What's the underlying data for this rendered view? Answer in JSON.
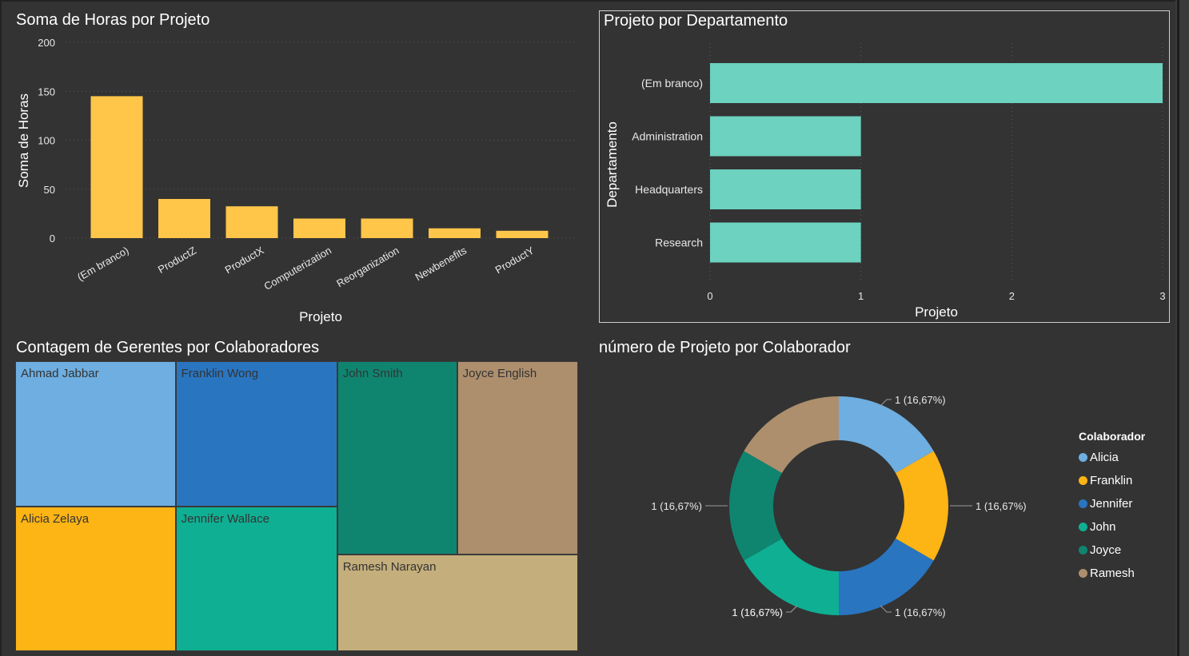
{
  "charts": {
    "hours": {
      "title": "Soma de Horas por Projeto"
    },
    "dept": {
      "title": "Projeto por Departamento"
    },
    "treemap": {
      "title": "Contagem de Gerentes por Colaboradores"
    },
    "donut": {
      "title": "número de Projeto por Colaborador",
      "legend_title": "Colaborador"
    }
  },
  "chart_data": [
    {
      "type": "bar",
      "title": "Soma de Horas por Projeto",
      "xlabel": "Projeto",
      "ylabel": "Soma de Horas",
      "categories": [
        "(Em branco)",
        "ProductZ",
        "ProductX",
        "Computerization",
        "Reorganization",
        "Newbenefits",
        "ProductY"
      ],
      "values": [
        145,
        40,
        32.5,
        20,
        20,
        10,
        7.5
      ],
      "ylim": [
        0,
        200
      ],
      "yticks": [
        "0",
        "50",
        "100",
        "150",
        "200"
      ],
      "color": "#FFC64A",
      "grid": true
    },
    {
      "type": "bar",
      "orientation": "horizontal",
      "title": "Projeto por Departamento",
      "xlabel": "Projeto",
      "ylabel": "Departamento",
      "categories": [
        "(Em branco)",
        "Administration",
        "Headquarters",
        "Research"
      ],
      "values": [
        3,
        1,
        1,
        1
      ],
      "xlim": [
        0,
        3
      ],
      "xticks": [
        "0",
        "1",
        "2",
        "3"
      ],
      "color": "#6DD2C0",
      "grid": true
    },
    {
      "type": "treemap",
      "title": "Contagem de Gerentes por Colaboradores",
      "items": [
        {
          "name": "Ahmad Jabbar",
          "color": "#6EAEE0"
        },
        {
          "name": "Franklin Wong",
          "color": "#2975C0"
        },
        {
          "name": "John Smith",
          "color": "#0F8570"
        },
        {
          "name": "Joyce English",
          "color": "#AD8F6D"
        },
        {
          "name": "Alicia Zelaya",
          "color": "#FDB415"
        },
        {
          "name": "Jennifer Wallace",
          "color": "#0FAF93"
        },
        {
          "name": "Ramesh Narayan",
          "color": "#C4AE7B"
        }
      ]
    },
    {
      "type": "pie",
      "donut": true,
      "title": "número de Projeto por Colaborador",
      "legend_title": "Colaborador",
      "legend_position": "right",
      "slices": [
        {
          "name": "Alicia",
          "value": 1,
          "label": "1 (16,67%)",
          "color": "#6EAEE0"
        },
        {
          "name": "Franklin",
          "value": 1,
          "label": "1 (16,67%)",
          "color": "#FDB415"
        },
        {
          "name": "Jennifer",
          "value": 1,
          "label": "1 (16,67%)",
          "color": "#2975C0"
        },
        {
          "name": "John",
          "value": 1,
          "label": "1 (16,67%)",
          "color": "#0FAF93"
        },
        {
          "name": "Joyce",
          "value": 1,
          "label": "1 (16,67%)",
          "color": "#0F8570"
        },
        {
          "name": "Ramesh",
          "value": 1,
          "label": "1 (16,67%)",
          "color": "#AD8F6D"
        }
      ]
    }
  ]
}
